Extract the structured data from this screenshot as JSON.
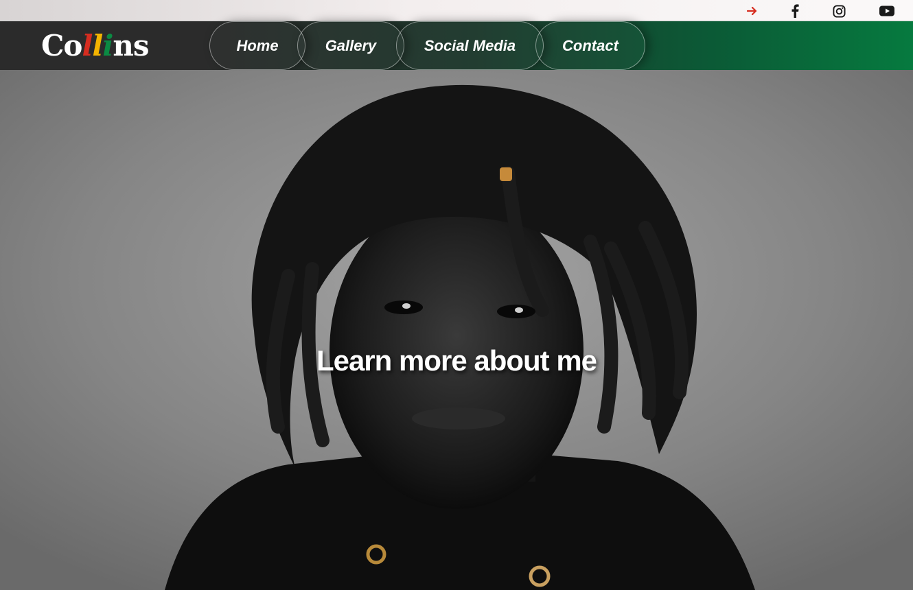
{
  "social_bar": {
    "icons": [
      "arrow-right-icon",
      "facebook-icon",
      "instagram-icon",
      "youtube-icon"
    ],
    "arrow_color": "#d62d20"
  },
  "brand": {
    "logo_parts": [
      "Co",
      "l",
      "l",
      "i",
      "ns"
    ],
    "logo_colors": [
      "#ffffff",
      "#d62d20",
      "#f4b400",
      "#0b8a43",
      "#ffffff"
    ]
  },
  "nav": {
    "items": [
      {
        "label": "Home"
      },
      {
        "label": "Gallery"
      },
      {
        "label": "Social Media"
      },
      {
        "label": "Contact"
      }
    ],
    "gradient_colors": [
      "#2b2b2b",
      "#067a3f"
    ]
  },
  "hero": {
    "title": "Learn more about me"
  }
}
